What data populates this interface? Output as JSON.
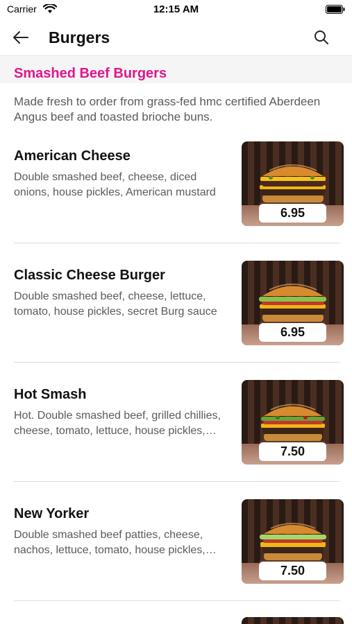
{
  "status_bar": {
    "carrier": "Carrier",
    "time": "12:15 AM"
  },
  "nav": {
    "title": "Burgers"
  },
  "section": {
    "title": "Smashed Beef Burgers",
    "description": "Made fresh to order from grass-fed hmc certified Aberdeen Angus beef and toasted brioche buns."
  },
  "items": [
    {
      "name": "American Cheese",
      "description": "Double smashed beef, cheese, diced onions, house pickles, American mustard",
      "price": "6.95"
    },
    {
      "name": "Classic Cheese Burger",
      "description": "Double smashed beef, cheese, lettuce, tomato, house pickles, secret Burg sauce",
      "price": "6.95"
    },
    {
      "name": "Hot Smash",
      "description": "Hot. Double smashed beef, grilled chillies, cheese, tomato, lettuce, house pickles, secret sauce",
      "price": "7.50"
    },
    {
      "name": "New Yorker",
      "description": "Double smashed beef patties, cheese, nachos, lettuce, tomato, house pickles, secret sauce",
      "price": "7.50"
    }
  ],
  "icons": {
    "back": "arrow-left-icon",
    "search": "search-icon",
    "wifi": "wifi-icon",
    "battery": "battery-icon"
  },
  "colors": {
    "accent": "#e0168e"
  }
}
